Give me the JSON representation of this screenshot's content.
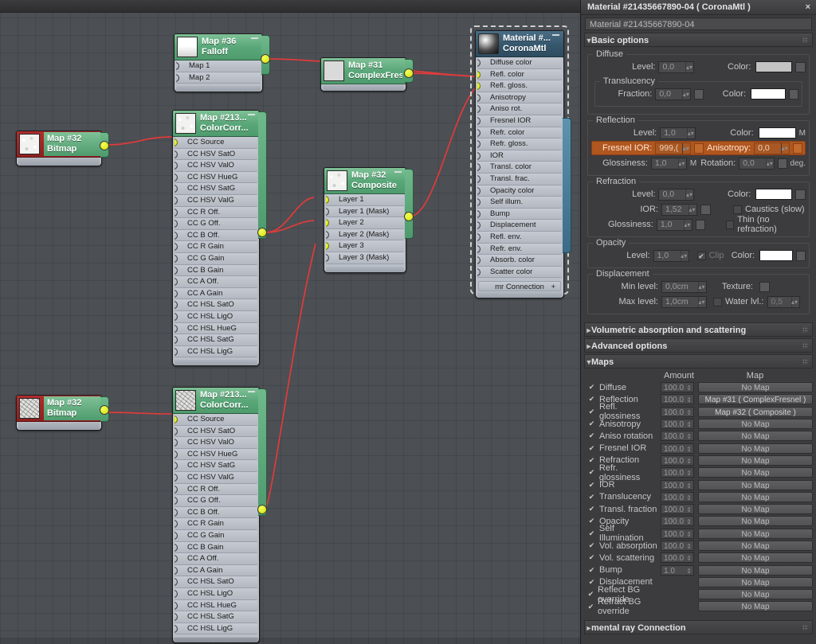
{
  "window": {
    "title": "Material #21435667890-04  ( CoronaMtl )",
    "close_icon": "×",
    "name_field_value": "Material #21435667890-04"
  },
  "rollouts": {
    "basic_options": "Basic options",
    "volumetric": "Volumetric absorption and scattering",
    "advanced": "Advanced options",
    "maps": "Maps",
    "mental_ray": "mental ray Connection",
    "expanded_tri": "▼",
    "collapsed_tri": "►"
  },
  "basic": {
    "diffuse": {
      "legend": "Diffuse",
      "level_label": "Level:",
      "level_value": "0,0",
      "color_label": "Color:",
      "color_hex": "#c3c3c3",
      "translucency": {
        "legend": "Translucency",
        "fraction_label": "Fraction:",
        "fraction_value": "0,0",
        "color_label": "Color:",
        "color_hex": "#ffffff"
      }
    },
    "reflection": {
      "legend": "Reflection",
      "level_label": "Level:",
      "level_value": "1,0",
      "color_label": "Color:",
      "color_hex": "#ffffff",
      "color_map_tag": "M",
      "fresnel_label": "Fresnel IOR:",
      "fresnel_value": "999,(",
      "anisotropy_label": "Anisotropy:",
      "anisotropy_value": "0,0",
      "glossiness_label": "Glossiness:",
      "glossiness_value": "1,0",
      "glossiness_map_tag": "M",
      "rotation_label": "Rotation:",
      "rotation_value": "0,0",
      "rotation_unit": "deg."
    },
    "refraction": {
      "legend": "Refraction",
      "level_label": "Level:",
      "level_value": "0,0",
      "color_label": "Color:",
      "color_hex": "#ffffff",
      "ior_label": "IOR:",
      "ior_value": "1,52",
      "caustics_label": "Caustics (slow)",
      "glossiness_label": "Glossiness:",
      "glossiness_value": "1,0",
      "thin_label": "Thin (no refraction)"
    },
    "opacity": {
      "legend": "Opacity",
      "level_label": "Level:",
      "level_value": "1,0",
      "clip_label": "Clip",
      "color_label": "Color:",
      "color_hex": "#ffffff"
    },
    "displacement": {
      "legend": "Displacement",
      "min_label": "Min level:",
      "min_value": "0,0cm",
      "texture_label": "Texture:",
      "max_label": "Max level:",
      "max_value": "1,0cm",
      "water_label": "Water lvl.:",
      "water_value": "0,5"
    }
  },
  "maps": {
    "col_amount": "Amount",
    "col_map": "Map",
    "no_map": "No Map",
    "rows": [
      {
        "name": "Diffuse",
        "checked": true,
        "amount": "100.0",
        "map": "No Map"
      },
      {
        "name": "Reflection",
        "checked": true,
        "amount": "100.0",
        "map": "Map #31  ( ComplexFresnel )"
      },
      {
        "name": "Refl. glossiness",
        "checked": true,
        "amount": "100.0",
        "map": "Map #32  ( Composite )"
      },
      {
        "name": "Anisotropy",
        "checked": true,
        "amount": "100.0",
        "map": "No Map"
      },
      {
        "name": "Aniso rotation",
        "checked": true,
        "amount": "100.0",
        "map": "No Map"
      },
      {
        "name": "Fresnel IOR",
        "checked": true,
        "amount": "100.0",
        "map": "No Map"
      },
      {
        "name": "Refraction",
        "checked": true,
        "amount": "100.0",
        "map": "No Map"
      },
      {
        "name": "Refr. glossiness",
        "checked": true,
        "amount": "100.0",
        "map": "No Map"
      },
      {
        "name": "IOR",
        "checked": true,
        "amount": "100.0",
        "map": "No Map"
      },
      {
        "name": "Translucency",
        "checked": true,
        "amount": "100.0",
        "map": "No Map"
      },
      {
        "name": "Transl. fraction",
        "checked": true,
        "amount": "100.0",
        "map": "No Map"
      },
      {
        "name": "Opacity",
        "checked": true,
        "amount": "100.0",
        "map": "No Map"
      },
      {
        "name": "Self Illumination",
        "checked": true,
        "amount": "100.0",
        "map": "No Map"
      },
      {
        "name": "Vol. absorption",
        "checked": true,
        "amount": "100.0",
        "map": "No Map"
      },
      {
        "name": "Vol. scattering",
        "checked": true,
        "amount": "100.0",
        "map": "No Map"
      },
      {
        "name": "Bump",
        "checked": true,
        "amount": "1.0",
        "map": "No Map"
      },
      {
        "name": "Displacement",
        "checked": true,
        "amount": "",
        "map": "No Map"
      },
      {
        "name": "Reflect BG override",
        "checked": true,
        "amount": "",
        "map": "No Map"
      },
      {
        "name": "Refract BG override",
        "checked": true,
        "amount": "",
        "map": "No Map"
      }
    ]
  },
  "graph": {
    "nodes": {
      "falloff": {
        "title": "Map #36",
        "subtitle": "Falloff",
        "slots": [
          "Map 1",
          "Map 2"
        ]
      },
      "fresnel": {
        "title": "Map #31",
        "subtitle": "ComplexFres...",
        "slots": []
      },
      "composite": {
        "title": "Map #32",
        "subtitle": "Composite",
        "slots": [
          "Layer 1",
          "Layer 1 (Mask)",
          "Layer 2",
          "Layer 2 (Mask)",
          "Layer 3",
          "Layer 3 (Mask)"
        ]
      },
      "cc_top": {
        "title": "Map #213...",
        "subtitle": "ColorCorr...",
        "slots": [
          "CC Source",
          "CC HSV SatO",
          "CC HSV ValO",
          "CC HSV HueG",
          "CC HSV SatG",
          "CC HSV ValG",
          "CC R Off.",
          "CC G Off.",
          "CC B Off.",
          "CC R Gain",
          "CC G Gain",
          "CC B Gain",
          "CC A Off.",
          "CC A Gain",
          "CC HSL SatO",
          "CC HSL LigO",
          "CC HSL HueG",
          "CC HSL SatG",
          "CC HSL LigG"
        ]
      },
      "cc_bottom": {
        "title": "Map #213...",
        "subtitle": "ColorCorr...",
        "slots": [
          "CC Source",
          "CC HSV SatO",
          "CC HSV ValO",
          "CC HSV HueG",
          "CC HSV SatG",
          "CC HSV ValG",
          "CC R Off.",
          "CC G Off.",
          "CC B Off.",
          "CC R Gain",
          "CC G Gain",
          "CC B Gain",
          "CC A Off.",
          "CC A Gain",
          "CC HSL SatO",
          "CC HSL LigO",
          "CC HSL HueG",
          "CC HSL SatG",
          "CC HSL LigG"
        ]
      },
      "bitmap_top": {
        "title": "Map #32",
        "subtitle": "Bitmap",
        "slots": []
      },
      "bitmap_bottom": {
        "title": "Map #32",
        "subtitle": "Bitmap",
        "slots": []
      },
      "material": {
        "title": "Material #...",
        "subtitle": "CoronaMtl",
        "slots": [
          "Diffuse color",
          "Refl. color",
          "Refl. gloss.",
          "Anisotropy",
          "Aniso rot.",
          "Fresnel IOR",
          "Refr. color",
          "Refr. gloss.",
          "IOR",
          "Transl. color",
          "Transl. frac.",
          "Opacity color",
          "Self illum.",
          "Bump",
          "Displacement",
          "Refl. env.",
          "Refr. env.",
          "Absorb. color",
          "Scatter color"
        ],
        "footer": "mr Connection",
        "footer_plus": "+"
      }
    },
    "wire_color": "#e03b3b"
  }
}
